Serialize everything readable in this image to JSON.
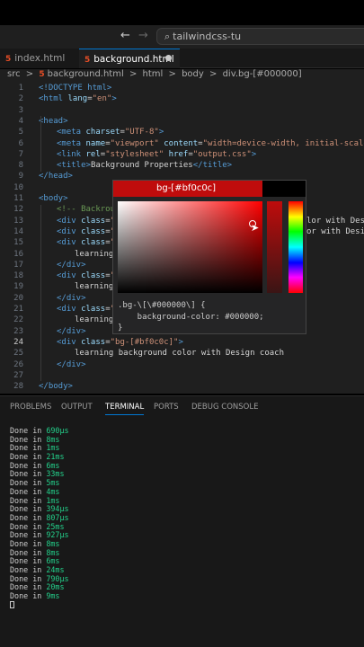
{
  "titlebar": {
    "back_glyph": "←",
    "forward_glyph": "→",
    "search_text": "tailwindcss-tu",
    "search_icon": "folder-search-icon"
  },
  "tabs": [
    {
      "label": "index.html",
      "icon": "html5-icon"
    },
    {
      "label": "background.html",
      "icon": "html5-icon",
      "modified": true
    }
  ],
  "breadcrumb": [
    "src",
    ">",
    "background.html",
    ">",
    "html",
    ">",
    "body",
    ">",
    "div.bg-[#000000]"
  ],
  "editor": {
    "lines": [
      {
        "n": "1",
        "indent": 0,
        "parts": [
          [
            "tg",
            "<!DOCTYPE html>"
          ]
        ]
      },
      {
        "n": "2",
        "indent": 0,
        "parts": [
          [
            "tg",
            "<html "
          ],
          [
            "at",
            "lang"
          ],
          [
            "tx",
            "="
          ],
          [
            "st",
            "\"en\""
          ],
          [
            "tg",
            ">"
          ]
        ]
      },
      {
        "n": "3",
        "indent": 0,
        "parts": []
      },
      {
        "n": "4",
        "indent": 0,
        "parts": [
          [
            "tg",
            "<head>"
          ]
        ]
      },
      {
        "n": "5",
        "indent": 1,
        "parts": [
          [
            "tg",
            "<meta "
          ],
          [
            "at",
            "charset"
          ],
          [
            "tx",
            "="
          ],
          [
            "st",
            "\"UTF-8\""
          ],
          [
            "tg",
            ">"
          ]
        ]
      },
      {
        "n": "6",
        "indent": 1,
        "parts": [
          [
            "tg",
            "<meta "
          ],
          [
            "at",
            "name"
          ],
          [
            "tx",
            "="
          ],
          [
            "st",
            "\"viewport\""
          ],
          [
            "at",
            " content"
          ],
          [
            "tx",
            "="
          ],
          [
            "st",
            "\"width=device-width, initial-scale=1.0\""
          ]
        ]
      },
      {
        "n": "7",
        "indent": 1,
        "parts": [
          [
            "tg",
            "<link "
          ],
          [
            "at",
            "rel"
          ],
          [
            "tx",
            "="
          ],
          [
            "st",
            "\"stylesheet\""
          ],
          [
            "at",
            " href"
          ],
          [
            "tx",
            "="
          ],
          [
            "st",
            "\"output.css\""
          ],
          [
            "tg",
            ">"
          ]
        ]
      },
      {
        "n": "8",
        "indent": 1,
        "parts": [
          [
            "tg",
            "<title>"
          ],
          [
            "tx",
            "Background Properties"
          ],
          [
            "tg",
            "</title>"
          ]
        ]
      },
      {
        "n": "9",
        "indent": 0,
        "parts": [
          [
            "tg",
            "</head>"
          ]
        ]
      },
      {
        "n": "10",
        "indent": 0,
        "parts": []
      },
      {
        "n": "11",
        "indent": 0,
        "parts": [
          [
            "tg",
            "<body>"
          ]
        ]
      },
      {
        "n": "12",
        "indent": 1,
        "parts": [
          [
            "cm",
            "<!-- Backrou"
          ]
        ]
      },
      {
        "n": "13",
        "indent": 1,
        "parts": [
          [
            "tg",
            "<div "
          ],
          [
            "at",
            "class"
          ],
          [
            "tx",
            "="
          ],
          [
            "st",
            "\"b"
          ]
        ],
        "tail": "lor with Desi"
      },
      {
        "n": "14",
        "indent": 1,
        "parts": [
          [
            "tg",
            "<div "
          ],
          [
            "at",
            "class"
          ],
          [
            "tx",
            "="
          ],
          [
            "st",
            "\"b"
          ]
        ],
        "tail": "or with Desig"
      },
      {
        "n": "15",
        "indent": 1,
        "parts": [
          [
            "tg",
            "<div "
          ],
          [
            "at",
            "class"
          ],
          [
            "tx",
            "="
          ],
          [
            "st",
            "\"b"
          ]
        ]
      },
      {
        "n": "16",
        "indent": 2,
        "parts": [
          [
            "tx",
            "learning"
          ]
        ]
      },
      {
        "n": "17",
        "indent": 1,
        "parts": [
          [
            "tg",
            "</div>"
          ]
        ]
      },
      {
        "n": "18",
        "indent": 1,
        "parts": [
          [
            "tg",
            "<div "
          ],
          [
            "at",
            "class"
          ],
          [
            "tx",
            "="
          ],
          [
            "st",
            "\"b"
          ]
        ]
      },
      {
        "n": "19",
        "indent": 2,
        "parts": [
          [
            "tx",
            "learning"
          ]
        ]
      },
      {
        "n": "20",
        "indent": 1,
        "parts": [
          [
            "tg",
            "</div>"
          ]
        ]
      },
      {
        "n": "21",
        "indent": 1,
        "parts": [
          [
            "tg",
            "<div "
          ],
          [
            "at",
            "class"
          ],
          [
            "tx",
            "="
          ],
          [
            "st",
            "\"b"
          ]
        ]
      },
      {
        "n": "22",
        "indent": 2,
        "parts": [
          [
            "tx",
            "learning"
          ]
        ]
      },
      {
        "n": "23",
        "indent": 1,
        "parts": [
          [
            "tg",
            "</div>"
          ]
        ]
      },
      {
        "n": "24",
        "indent": 1,
        "current": true,
        "parts": [
          [
            "tg",
            "<div "
          ],
          [
            "at",
            "class"
          ],
          [
            "tx",
            "="
          ],
          [
            "st",
            "\"bg-[#bf0c0c]\""
          ],
          [
            "tg",
            ">"
          ]
        ]
      },
      {
        "n": "25",
        "indent": 2,
        "parts": [
          [
            "tx",
            "learning background color with Design coach"
          ]
        ]
      },
      {
        "n": "26",
        "indent": 1,
        "parts": [
          [
            "tg",
            "</div>"
          ]
        ]
      },
      {
        "n": "27",
        "indent": 0,
        "parts": []
      },
      {
        "n": "28",
        "indent": 0,
        "parts": [
          [
            "tg",
            "</body>"
          ]
        ]
      }
    ]
  },
  "color_picker": {
    "color_label": "bg-[#bf0c0c]",
    "hover_line1": ".bg-\\[\\#000000\\] {",
    "hover_line2": "    background-color: #000000;",
    "hover_line3": "}",
    "current_color": "#bf0c0c",
    "original_color": "#000000"
  },
  "panel": {
    "tabs": [
      "PROBLEMS",
      "OUTPUT",
      "TERMINAL",
      "PORTS",
      "DEBUG CONSOLE"
    ],
    "active_tab": "TERMINAL",
    "terminal_lines": [
      {
        "text": "Done in ",
        "num": "690µs"
      },
      {
        "text": "Done in ",
        "num": "8ms"
      },
      {
        "text": "Done in ",
        "num": "1ms"
      },
      {
        "text": "Done in ",
        "num": "21ms"
      },
      {
        "text": "Done in ",
        "num": "6ms"
      },
      {
        "text": "Done in ",
        "num": "33ms"
      },
      {
        "text": "Done in ",
        "num": "5ms"
      },
      {
        "text": "Done in ",
        "num": "4ms"
      },
      {
        "text": "Done in ",
        "num": "1ms"
      },
      {
        "text": "Done in ",
        "num": "394µs"
      },
      {
        "text": "Done in ",
        "num": "807µs"
      },
      {
        "text": "Done in ",
        "num": "25ms"
      },
      {
        "text": "Done in ",
        "num": "927µs"
      },
      {
        "text": "Done in ",
        "num": "8ms"
      },
      {
        "text": "Done in ",
        "num": "8ms"
      },
      {
        "text": "Done in ",
        "num": "6ms"
      },
      {
        "text": "Done in ",
        "num": "24ms"
      },
      {
        "text": "Done in ",
        "num": "790µs"
      },
      {
        "text": "Done in ",
        "num": "20ms"
      },
      {
        "text": "Done in ",
        "num": "9ms"
      }
    ]
  }
}
